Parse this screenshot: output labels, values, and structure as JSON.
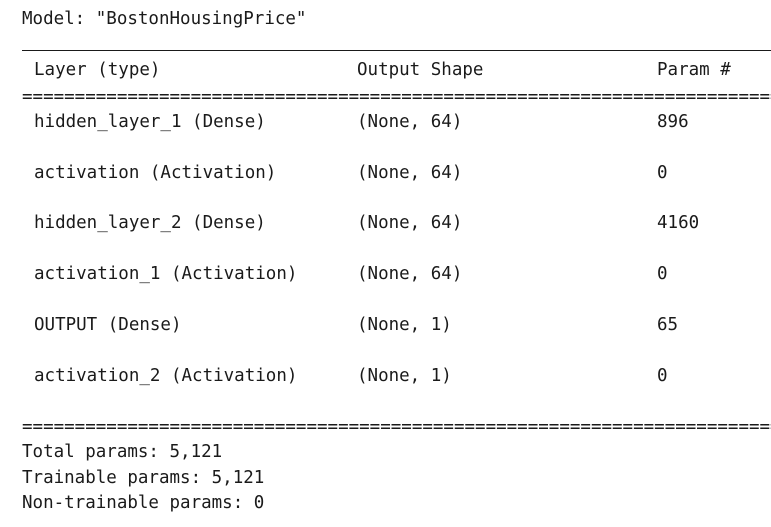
{
  "model": {
    "title": "Model: \"BostonHousingPrice\""
  },
  "headers": {
    "layer": "Layer (type)",
    "shape": "Output Shape",
    "params": "Param #"
  },
  "rows": [
    {
      "layer": "hidden_layer_1 (Dense)",
      "shape": "(None, 64)",
      "params": "896"
    },
    {
      "layer": "activation (Activation)",
      "shape": "(None, 64)",
      "params": "0"
    },
    {
      "layer": "hidden_layer_2 (Dense)",
      "shape": "(None, 64)",
      "params": "4160"
    },
    {
      "layer": "activation_1 (Activation)",
      "shape": "(None, 64)",
      "params": "0"
    },
    {
      "layer": "OUTPUT (Dense)",
      "shape": "(None, 1)",
      "params": "65"
    },
    {
      "layer": "activation_2 (Activation)",
      "shape": "(None, 1)",
      "params": "0"
    }
  ],
  "totals": {
    "total": "Total params: 5,121",
    "trainable": "Trainable params: 5,121",
    "non_trainable": "Non-trainable params: 0"
  },
  "separators": {
    "equals": "=================================================================================================="
  }
}
